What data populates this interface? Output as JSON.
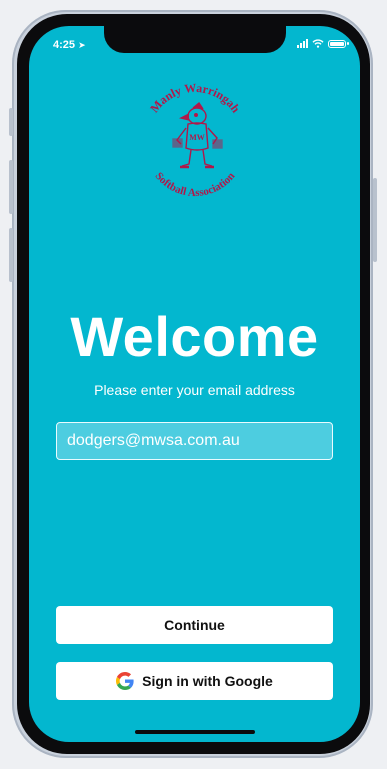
{
  "status_bar": {
    "time": "4:25"
  },
  "logo": {
    "text_top": "Manly Warringah",
    "text_bottom": "Softball Association",
    "badge": "MW"
  },
  "welcome": {
    "title": "Welcome",
    "subtitle": "Please enter your email address"
  },
  "email": {
    "value": "dodgers@mwsa.com.au"
  },
  "buttons": {
    "continue_label": "Continue",
    "google_label": "Sign in with Google"
  },
  "colors": {
    "screen_bg": "#03b7cf",
    "logo": "#b0184a",
    "button_bg": "#ffffff"
  }
}
